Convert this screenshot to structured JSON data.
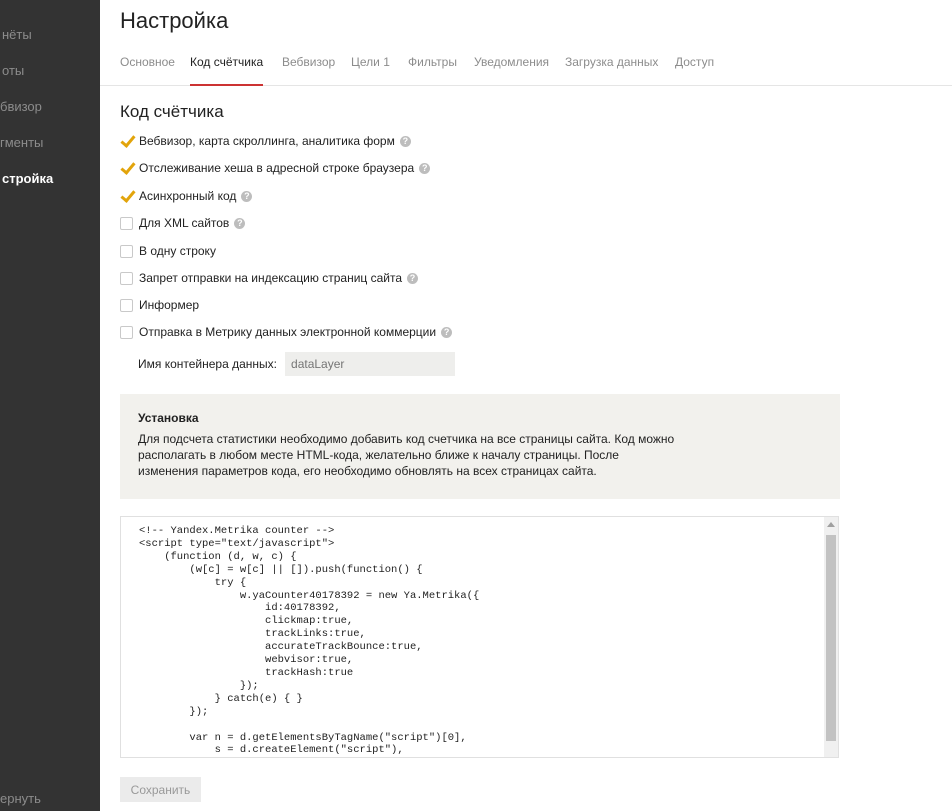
{
  "sidebar": {
    "items": [
      {
        "label": "нёты"
      },
      {
        "label": "оты"
      },
      {
        "label": "бвизор"
      },
      {
        "label": "гменты"
      },
      {
        "label": "стройка"
      }
    ],
    "bottom": "ернуть"
  },
  "header": {
    "title": "Настройка"
  },
  "tabs": [
    {
      "label": "Основное"
    },
    {
      "label": "Код счётчика"
    },
    {
      "label": "Вебвизор"
    },
    {
      "label": "Цели 1"
    },
    {
      "label": "Фильтры"
    },
    {
      "label": "Уведомления"
    },
    {
      "label": "Загрузка данных"
    },
    {
      "label": "Доступ"
    }
  ],
  "section": {
    "title": "Код счётчика"
  },
  "options": [
    {
      "label": "Вебвизор, карта скроллинга, аналитика форм",
      "checked": true
    },
    {
      "label": "Отслеживание хеша в адресной строке браузера",
      "checked": true
    },
    {
      "label": "Асинхронный код",
      "checked": true
    },
    {
      "label": "Для XML сайтов",
      "checked": false
    },
    {
      "label": "В одну строку",
      "checked": false
    },
    {
      "label": "Запрет отправки на индексацию страниц сайта",
      "checked": false
    },
    {
      "label": "Информер",
      "checked": false
    },
    {
      "label": "Отправка в Метрику данных электронной коммерции",
      "checked": false
    }
  ],
  "container": {
    "label": "Имя контейнера данных:",
    "placeholder": "dataLayer"
  },
  "install": {
    "title": "Установка",
    "text": "Для подсчета статистики необходимо добавить код счетчика на все страницы сайта. Код можно располагать в любом месте HTML-кода, желательно ближе к началу страницы. После изменения параметров кода, его необходимо обновлять на всех страницах сайта."
  },
  "code": "<!-- Yandex.Metrika counter -->\n<script type=\"text/javascript\">\n    (function (d, w, c) {\n        (w[c] = w[c] || []).push(function() {\n            try {\n                w.yaCounter40178392 = new Ya.Metrika({\n                    id:40178392,\n                    clickmap:true,\n                    trackLinks:true,\n                    accurateTrackBounce:true,\n                    webvisor:true,\n                    trackHash:true\n                });\n            } catch(e) { }\n        });\n\n        var n = d.getElementsByTagName(\"script\")[0],\n            s = d.createElement(\"script\"),",
  "save": "Сохранить",
  "colors": {
    "accent": "#cc3333",
    "check": "#e2a40b",
    "sidebar": "#333333"
  }
}
